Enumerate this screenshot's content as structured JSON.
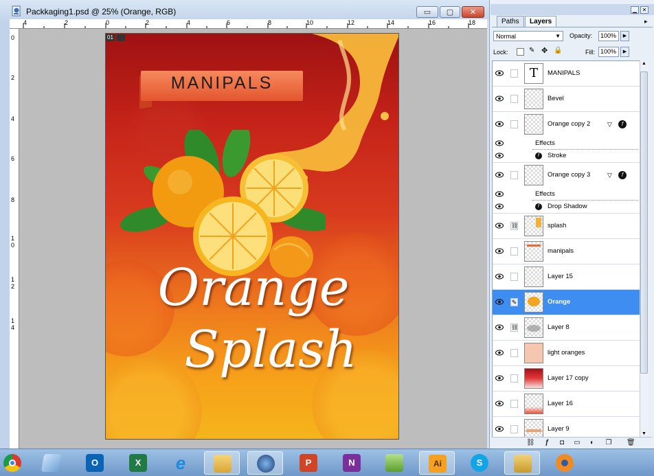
{
  "window": {
    "title": "Packkaging1.psd @ 25% (Orange, RGB)",
    "buttons": {
      "minimize": "▭",
      "restore": "▢",
      "close": "✕"
    },
    "frame_badge": "01"
  },
  "rulers": {
    "top": [
      "4",
      "2",
      "0",
      "2",
      "4",
      "6",
      "8",
      "10",
      "12",
      "14",
      "16",
      "18"
    ],
    "left": [
      "0",
      "2",
      "4",
      "6",
      "8",
      "1",
      "0",
      "1",
      "2",
      "1",
      "4"
    ]
  },
  "artwork": {
    "brand": "MANIPALS",
    "title_line1": "Orange",
    "title_line2": "Splash"
  },
  "layers_panel": {
    "tabs": [
      {
        "label": "Paths",
        "active": false
      },
      {
        "label": "Layers",
        "active": true
      }
    ],
    "blend_mode": "Normal",
    "opacity_label": "Opacity:",
    "opacity_value": "100%",
    "lock_label": "Lock:",
    "fill_label": "Fill:",
    "fill_value": "100%",
    "layers": [
      {
        "name": "MANIPALS",
        "type": "text"
      },
      {
        "name": "Bevel"
      },
      {
        "name": "Orange  copy 2",
        "has_fx": true,
        "effects_label": "Effects",
        "effects": [
          "Stroke"
        ]
      },
      {
        "name": "Orange  copy 3",
        "has_fx": true,
        "effects_label": "Effects",
        "effects": [
          "Drop Shadow"
        ]
      },
      {
        "name": "splash",
        "linked": true
      },
      {
        "name": "manipals"
      },
      {
        "name": "Layer 15"
      },
      {
        "name": "Orange",
        "selected": true,
        "brush": true
      },
      {
        "name": "Layer 8",
        "linked": true
      },
      {
        "name": "light oranges"
      },
      {
        "name": "Layer 17 copy"
      },
      {
        "name": "Layer 16"
      },
      {
        "name": "Layer 9"
      }
    ]
  },
  "taskbar": {
    "items": [
      {
        "name": "chrome",
        "label": ""
      },
      {
        "name": "notepad",
        "label": ""
      },
      {
        "name": "outlook",
        "label": "O"
      },
      {
        "name": "excel",
        "label": "X"
      },
      {
        "name": "internet-explorer",
        "label": "e"
      },
      {
        "name": "file-explorer",
        "label": ""
      },
      {
        "name": "photoshop-cs",
        "label": ""
      },
      {
        "name": "powerpoint",
        "label": "P"
      },
      {
        "name": "onenote",
        "label": "N"
      },
      {
        "name": "pen-app",
        "label": ""
      },
      {
        "name": "illustrator",
        "label": "Ai"
      },
      {
        "name": "skype",
        "label": "S"
      },
      {
        "name": "archive",
        "label": ""
      },
      {
        "name": "blender",
        "label": ""
      }
    ]
  }
}
